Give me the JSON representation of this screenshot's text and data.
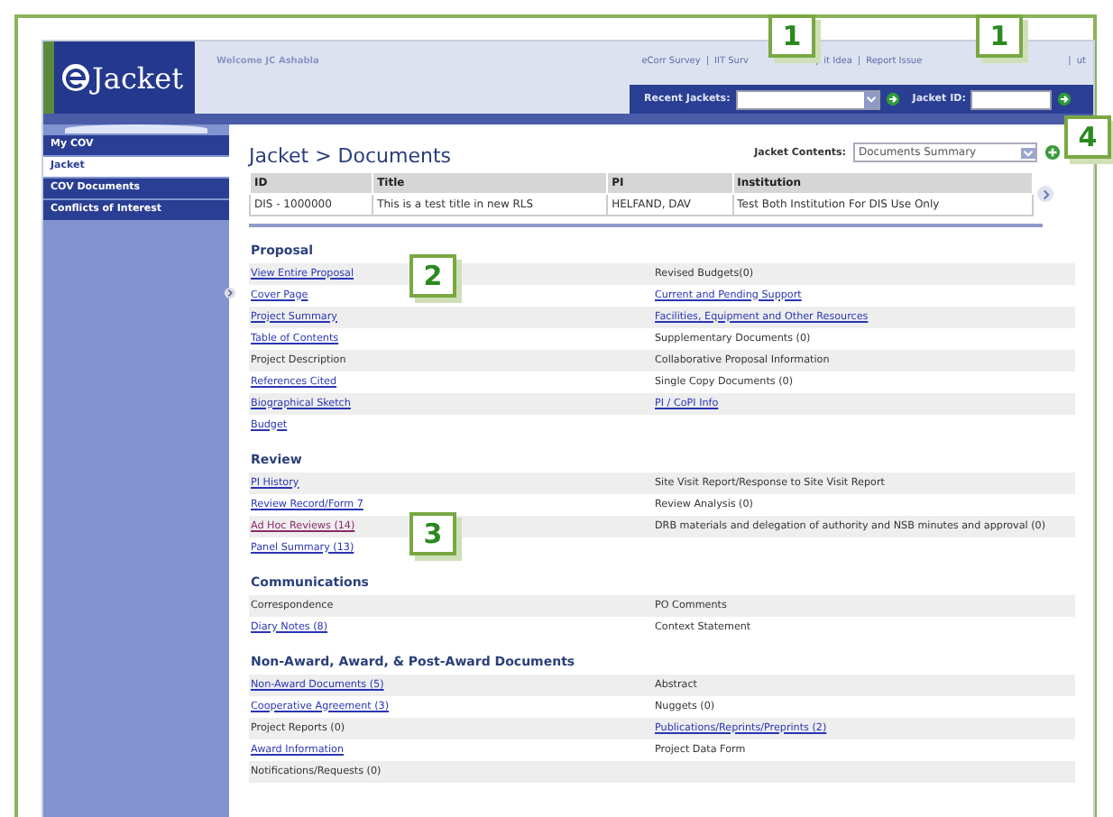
{
  "header": {
    "logo": "Jacket",
    "welcome": "Welcome JC Ashabla",
    "top_links": [
      "eCorr Survey",
      "IIT Surv",
      "it Idea",
      "Report Issue",
      "ut"
    ],
    "link_separator": "|",
    "recent_jackets": {
      "label": "Recent Jackets:"
    },
    "jacket_id": {
      "label": "Jacket ID:"
    }
  },
  "sidebar": {
    "items": [
      {
        "label": "My COV",
        "selected": false
      },
      {
        "label": "Jacket",
        "selected": true
      },
      {
        "label": "COV Documents",
        "selected": false
      },
      {
        "label": "Conflicts of Interest",
        "selected": false
      }
    ]
  },
  "page_title": "Jacket > Documents",
  "jacket_contents": {
    "label": "Jacket Contents:",
    "value": "Documents Summary"
  },
  "table": {
    "columns": [
      "ID",
      "Title",
      "PI",
      "Institution"
    ],
    "rows": [
      [
        "DIS - 1000000",
        "This is a test title in new RLS",
        "HELFAND, DAV",
        "Test Both Institution For DIS Use Only"
      ]
    ]
  },
  "sections": [
    {
      "title": "Proposal",
      "rows": [
        [
          {
            "text": "View Entire Proposal",
            "kind": "link"
          },
          {
            "text": "Revised Budgets(0)",
            "kind": "plain"
          }
        ],
        [
          {
            "text": "Cover Page",
            "kind": "link"
          },
          {
            "text": "Current and Pending Support",
            "kind": "link"
          }
        ],
        [
          {
            "text": "Project Summary",
            "kind": "link"
          },
          {
            "text": "Facilities, Equipment and Other Resources",
            "kind": "link"
          }
        ],
        [
          {
            "text": "Table of Contents",
            "kind": "link"
          },
          {
            "text": "Supplementary Documents (0)",
            "kind": "plain"
          }
        ],
        [
          {
            "text": "Project Description",
            "kind": "plain"
          },
          {
            "text": "Collaborative Proposal Information",
            "kind": "plain"
          }
        ],
        [
          {
            "text": "References Cited",
            "kind": "link"
          },
          {
            "text": "Single Copy Documents (0)",
            "kind": "plain"
          }
        ],
        [
          {
            "text": "Biographical Sketch",
            "kind": "link"
          },
          {
            "text": "PI / CoPI Info",
            "kind": "link"
          }
        ],
        [
          {
            "text": "Budget",
            "kind": "link"
          }
        ]
      ]
    },
    {
      "title": "Review",
      "rows": [
        [
          {
            "text": "PI History",
            "kind": "link"
          },
          {
            "text": "Site Visit Report/Response to Site Visit Report",
            "kind": "plain"
          }
        ],
        [
          {
            "text": "Review Record/Form 7",
            "kind": "link"
          },
          {
            "text": "Review Analysis (0)",
            "kind": "plain"
          }
        ],
        [
          {
            "text": "Ad Hoc Reviews (14)",
            "kind": "visited"
          },
          {
            "text": "DRB materials and delegation of authority and NSB minutes and approval (0)",
            "kind": "plain"
          }
        ],
        [
          {
            "text": "Panel Summary (13)",
            "kind": "link"
          }
        ]
      ]
    },
    {
      "title": "Communications",
      "rows": [
        [
          {
            "text": "Correspondence",
            "kind": "plain"
          },
          {
            "text": "PO Comments",
            "kind": "plain"
          }
        ],
        [
          {
            "text": "Diary Notes (8)",
            "kind": "link"
          },
          {
            "text": "Context Statement",
            "kind": "plain"
          }
        ]
      ]
    },
    {
      "title": "Non-Award, Award, & Post-Award Documents",
      "rows": [
        [
          {
            "text": "Non-Award Documents (5)",
            "kind": "link"
          },
          {
            "text": "Abstract",
            "kind": "plain"
          }
        ],
        [
          {
            "text": "Cooperative Agreement (3)",
            "kind": "link"
          },
          {
            "text": "Nuggets (0)",
            "kind": "plain"
          }
        ],
        [
          {
            "text": "Project Reports (0)",
            "kind": "plain"
          },
          {
            "text": "Publications/Reprints/Preprints (2)",
            "kind": "link"
          }
        ],
        [
          {
            "text": "Award Information",
            "kind": "link"
          },
          {
            "text": "Project Data Form",
            "kind": "plain"
          }
        ],
        [
          {
            "text": "Notifications/Requests (0)",
            "kind": "plain"
          }
        ]
      ]
    }
  ],
  "callouts": [
    "1",
    "1",
    "4",
    "2",
    "3"
  ]
}
